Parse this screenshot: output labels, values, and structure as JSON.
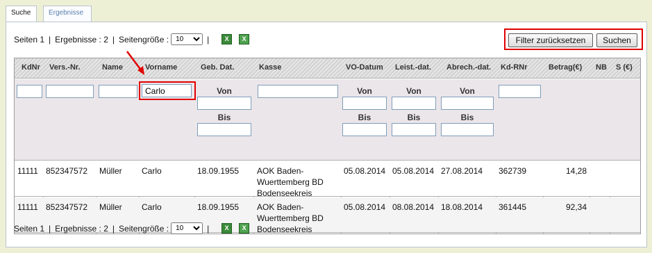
{
  "tabs": [
    "Suche",
    "Ergebnisse"
  ],
  "pager": {
    "pages_label": "Seiten 1",
    "sep": "|",
    "results_label": "Ergebnisse : 2",
    "page_size_label": "Seitengröße :",
    "page_size_value": "10"
  },
  "buttons": {
    "reset": "Filter zurücksetzen",
    "search": "Suchen"
  },
  "columns": [
    "KdNr",
    "Vers.-Nr.",
    "Name",
    "Vorname",
    "Geb. Dat.",
    "Kasse",
    "VO-Datum",
    "Leist.-dat.",
    "Abrech.-dat.",
    "Kd-RNr",
    "Betrag(€)",
    "NB",
    "S (€)"
  ],
  "filter": {
    "vorname_value": "Carlo",
    "von": "Von",
    "bis": "Bis"
  },
  "rows": [
    {
      "kdnr": "11111",
      "versnr": "852347572",
      "name": "Müller",
      "vorname": "Carlo",
      "geb": "18.09.1955",
      "kasse1": "AOK Baden-",
      "kasse2": "Wuerttemberg BD",
      "kasse3": "Bodenseekreis",
      "vo": "05.08.2014",
      "leist": "05.08.2014",
      "abrech": "27.08.2014",
      "rnr": "362739",
      "betrag": "14,28"
    },
    {
      "kdnr": "11111",
      "versnr": "852347572",
      "name": "Müller",
      "vorname": "Carlo",
      "geb": "18.09.1955",
      "kasse1": "AOK Baden-",
      "kasse2": "Wuerttemberg BD",
      "kasse3": "Bodenseekreis",
      "vo": "05.08.2014",
      "leist": "08.08.2014",
      "abrech": "18.08.2014",
      "rnr": "361445",
      "betrag": "92,34"
    }
  ],
  "icons": {
    "export1": "excel-export-icon",
    "export2": "excel-icon"
  },
  "colors": {
    "highlight": "#e10000",
    "background": "#eef0d6"
  }
}
